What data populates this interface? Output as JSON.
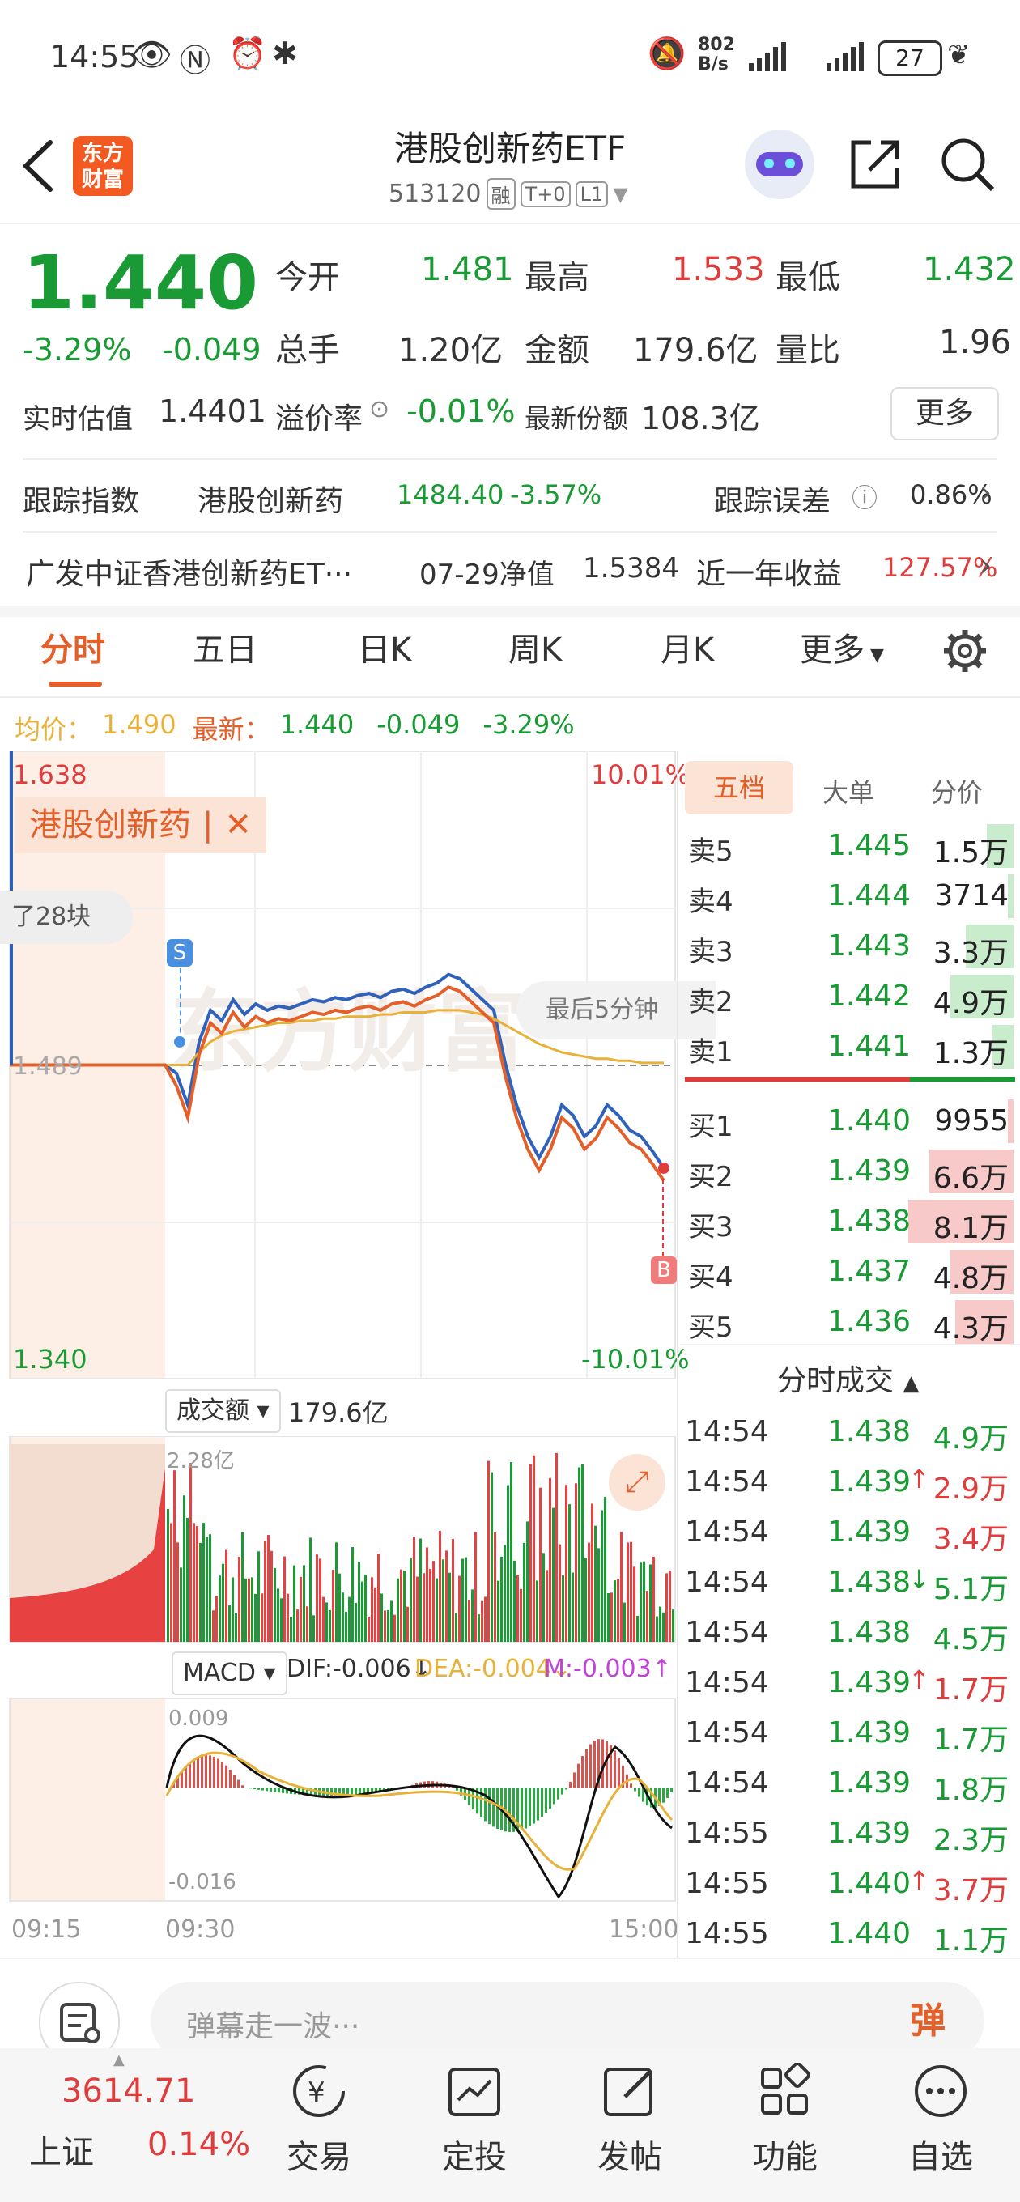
{
  "status": {
    "time": "14:55",
    "net_speed": "802\nB/s",
    "net_top": "802",
    "net_bottom": "B/s",
    "battery": "27"
  },
  "header": {
    "logo_line1": "东方",
    "logo_line2": "财富",
    "title": "港股创新药ETF",
    "code": "513120",
    "tags": [
      "融",
      "T+0",
      "L1"
    ]
  },
  "quote": {
    "price": "1.440",
    "change_pct": "-3.29%",
    "change": "-0.049",
    "open_label": "今开",
    "open": "1.481",
    "high_label": "最高",
    "high": "1.533",
    "low_label": "最低",
    "low": "1.432",
    "volume_label": "总手",
    "volume": "1.20亿",
    "amount_label": "金额",
    "amount": "179.6亿",
    "ratio_label": "量比",
    "ratio": "1.96",
    "iopv_label": "实时估值",
    "iopv": "1.4401",
    "premium_label": "溢价率",
    "premium": "-0.01%",
    "shares_label": "最新份额",
    "shares": "108.3亿",
    "more": "更多"
  },
  "track": {
    "label": "跟踪指数",
    "index_name": "港股创新药",
    "index_value": "1484.40",
    "index_change": "-3.57%",
    "error_label": "跟踪误差",
    "error_value": "0.86%"
  },
  "fund": {
    "name": "广发中证香港创新药ET···",
    "nav_label": "07-29净值",
    "nav": "1.5384",
    "year_label": "近一年收益",
    "year_return": "127.57%"
  },
  "tabs": [
    "分时",
    "五日",
    "日K",
    "周K",
    "月K",
    "更多"
  ],
  "info_line": {
    "avg_label": "均价：",
    "avg": "1.490",
    "latest_label": "最新：",
    "latest": "1.440",
    "change": "-0.049",
    "pct": "-3.29%"
  },
  "chart": {
    "y_top": "1.638",
    "y_mid": "1.489",
    "y_bot": "1.340",
    "pct_top": "10.01%",
    "pct_bot": "-10.01%",
    "index_tag": "港股创新药",
    "toast": "了28块",
    "last5": "最后5分钟",
    "marker_s": "S",
    "marker_b": "B",
    "watermark": "东方财富",
    "vol_label": "成交额",
    "vol_total": "179.6亿",
    "vol_max": "2.28亿",
    "macd_label": "MACD",
    "dif": "DIF:-0.006↓",
    "dea": "DEA:-0.004↓",
    "m": "M:-0.003↑",
    "macd_top": "0.009",
    "macd_bot": "-0.016",
    "time_start": "09:15",
    "time_open": "09:30",
    "time_end": "15:00"
  },
  "chart_data": {
    "type": "line",
    "title": "",
    "y_range": [
      1.34,
      1.638
    ],
    "prev_close": 1.489,
    "series": [
      {
        "name": "最新",
        "values": [
          1.489,
          1.489,
          1.489,
          1.489,
          1.485,
          1.47,
          1.5,
          1.515,
          1.51,
          1.52,
          1.513,
          1.518,
          1.515,
          1.517,
          1.516,
          1.518,
          1.52,
          1.519,
          1.521,
          1.52,
          1.522,
          1.523,
          1.521,
          1.524,
          1.525,
          1.523,
          1.526,
          1.528,
          1.532,
          1.53,
          1.525,
          1.52,
          1.515,
          1.49,
          1.47,
          1.455,
          1.445,
          1.455,
          1.47,
          1.465,
          1.455,
          1.46,
          1.47,
          1.465,
          1.458,
          1.455,
          1.448,
          1.44
        ]
      },
      {
        "name": "均价",
        "values": [
          1.489,
          1.489,
          1.489,
          1.489,
          1.489,
          1.489,
          1.495,
          1.5,
          1.503,
          1.505,
          1.506,
          1.507,
          1.508,
          1.509,
          1.509,
          1.51,
          1.51,
          1.511,
          1.511,
          1.512,
          1.512,
          1.512,
          1.513,
          1.513,
          1.514,
          1.514,
          1.514,
          1.515,
          1.515,
          1.515,
          1.514,
          1.513,
          1.511,
          1.508,
          1.505,
          1.502,
          1.499,
          1.497,
          1.495,
          1.494,
          1.493,
          1.492,
          1.492,
          1.491,
          1.491,
          1.49,
          1.49,
          1.49
        ]
      }
    ]
  },
  "order_book": {
    "tabs": [
      "五档",
      "大单",
      "分价"
    ],
    "asks": [
      {
        "label": "卖5",
        "price": "1.445",
        "vol": "1.5万",
        "bar": 0.25
      },
      {
        "label": "卖4",
        "price": "1.444",
        "vol": "3714",
        "bar": 0.05
      },
      {
        "label": "卖3",
        "price": "1.443",
        "vol": "3.3万",
        "bar": 0.45
      },
      {
        "label": "卖2",
        "price": "1.442",
        "vol": "4.9万",
        "bar": 0.6
      },
      {
        "label": "卖1",
        "price": "1.441",
        "vol": "1.3万",
        "bar": 0.2
      }
    ],
    "bids": [
      {
        "label": "买1",
        "price": "1.440",
        "vol": "9955",
        "bar": 0.05
      },
      {
        "label": "买2",
        "price": "1.439",
        "vol": "6.6万",
        "bar": 0.8
      },
      {
        "label": "买3",
        "price": "1.438",
        "vol": "8.1万",
        "bar": 1.0
      },
      {
        "label": "买4",
        "price": "1.437",
        "vol": "4.8万",
        "bar": 0.6
      },
      {
        "label": "买5",
        "price": "1.436",
        "vol": "4.3万",
        "bar": 0.55
      }
    ]
  },
  "ticks_title": "分时成交",
  "ticks": [
    {
      "time": "14:54",
      "price": "1.438",
      "dir": "",
      "vol": "4.9万",
      "color": "g"
    },
    {
      "time": "14:54",
      "price": "1.439",
      "dir": "↑",
      "vol": "2.9万",
      "color": "r"
    },
    {
      "time": "14:54",
      "price": "1.439",
      "dir": "",
      "vol": "3.4万",
      "color": "r"
    },
    {
      "time": "14:54",
      "price": "1.438",
      "dir": "↓",
      "vol": "5.1万",
      "color": "g"
    },
    {
      "time": "14:54",
      "price": "1.438",
      "dir": "",
      "vol": "4.5万",
      "color": "g"
    },
    {
      "time": "14:54",
      "price": "1.439",
      "dir": "↑",
      "vol": "1.7万",
      "color": "r"
    },
    {
      "time": "14:54",
      "price": "1.439",
      "dir": "",
      "vol": "1.7万",
      "color": "g"
    },
    {
      "time": "14:54",
      "price": "1.439",
      "dir": "",
      "vol": "1.8万",
      "color": "g"
    },
    {
      "time": "14:55",
      "price": "1.439",
      "dir": "",
      "vol": "2.3万",
      "color": "g"
    },
    {
      "time": "14:55",
      "price": "1.440",
      "dir": "↑",
      "vol": "3.7万",
      "color": "r"
    },
    {
      "time": "14:55",
      "price": "1.440",
      "dir": "",
      "vol": "1.1万",
      "color": "g"
    }
  ],
  "comment": {
    "placeholder": "弹幕走一波···",
    "danmu_btn": "弹"
  },
  "bottom": {
    "index_value": "3614.71",
    "index_name": "上证",
    "index_pct": "0.14%",
    "nav": [
      "交易",
      "定投",
      "发帖",
      "功能",
      "自选"
    ]
  },
  "colors": {
    "up": "#e03c3c",
    "down": "#1a9a34",
    "accent": "#e4602a",
    "avg": "#e8b23a",
    "price_line": "#2f62b8"
  }
}
